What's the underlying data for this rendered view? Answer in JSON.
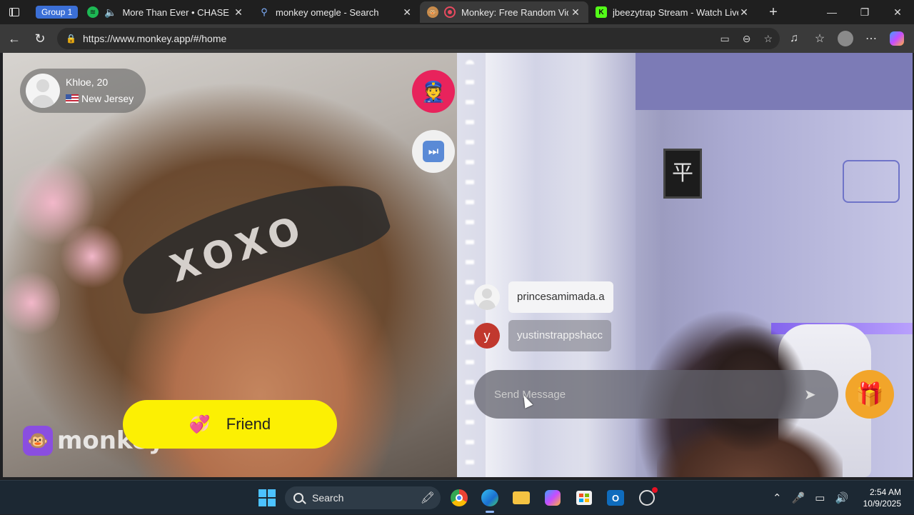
{
  "browser": {
    "tab_group": "Group 1",
    "tabs": [
      {
        "title": "More Than Ever • CHASETHI",
        "favicon": "spotify-icon",
        "audio": true
      },
      {
        "title": "monkey omegle - Search",
        "favicon": "search-icon"
      },
      {
        "title": "Monkey: Free Random Vide",
        "favicon": "monkey-icon",
        "active": true,
        "recording": true
      },
      {
        "title": "jbeezytrap Stream - Watch Live o",
        "favicon": "kick-icon"
      }
    ],
    "url": "https://www.monkey.app/#/home"
  },
  "video": {
    "partner_name": "Khloe, 20",
    "partner_location": "New Jersey",
    "logo_text": "monkey",
    "friend_label": "Friend"
  },
  "chat": {
    "messages": [
      {
        "avatar": "",
        "text": "princesamimada.a"
      },
      {
        "avatar": "y",
        "text": "yustinstrappshacc"
      }
    ],
    "input_placeholder": "Send Message"
  },
  "taskbar": {
    "search_label": "Search",
    "time": "2:54 AM",
    "date": "10/9/2025"
  },
  "colors": {
    "friend_button": "#fcf003",
    "report_button": "#e8235c",
    "gift_button": "#f2a52a",
    "tab_group": "#3b6fd6"
  }
}
